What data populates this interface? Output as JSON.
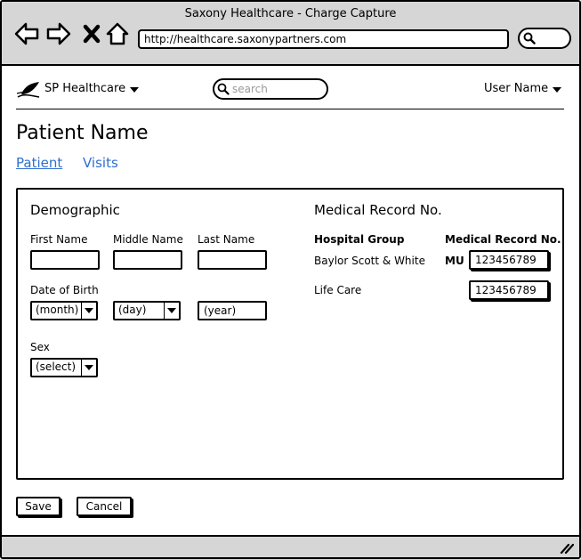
{
  "browser": {
    "window_title": "Saxony Healthcare - Charge Capture",
    "url": "http://healthcare.saxonypartners.com"
  },
  "header": {
    "brand": "SP Healthcare",
    "search_placeholder": "search",
    "user": "User Name"
  },
  "page": {
    "title": "Patient Name",
    "tabs": [
      {
        "label": "Patient",
        "active": true
      },
      {
        "label": "Visits",
        "active": false
      }
    ]
  },
  "demographic": {
    "title": "Demographic",
    "first_name_label": "First Name",
    "middle_name_label": "Middle Name",
    "last_name_label": "Last Name",
    "dob_label": "Date of Birth",
    "dob_month": "(month)",
    "dob_day": "(day)",
    "dob_year": "(year)",
    "sex_label": "Sex",
    "sex_value": "(select)"
  },
  "medical_record": {
    "title": "Medical Record No.",
    "col_hospital": "Hospital Group",
    "col_mrn": "Medical Record No.",
    "rows": [
      {
        "hospital": "Baylor Scott & White",
        "prefix": "MU",
        "mrn": "123456789"
      },
      {
        "hospital": "Life Care",
        "prefix": "",
        "mrn": "123456789"
      }
    ]
  },
  "actions": {
    "save": "Save",
    "cancel": "Cancel"
  }
}
